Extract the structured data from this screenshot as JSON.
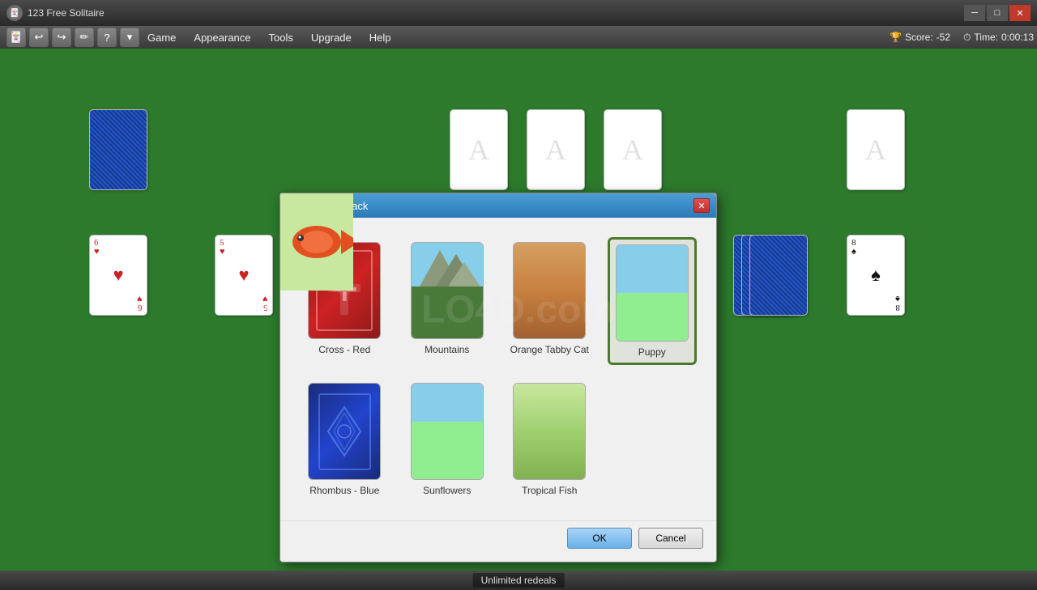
{
  "window": {
    "title": "123 Free Solitaire",
    "min_label": "─",
    "max_label": "□",
    "close_label": "✕"
  },
  "toolbar": {
    "icons": [
      "🃏",
      "↩",
      "↪",
      "✏",
      "?",
      "▾"
    ]
  },
  "menu": {
    "items": [
      "Game",
      "Appearance",
      "Tools",
      "Upgrade",
      "Help"
    ]
  },
  "hud": {
    "score_label": "Score:",
    "score_value": "-52",
    "time_label": "Time:",
    "time_value": "0:00:13"
  },
  "status_bar": {
    "message": "Unlimited redeals"
  },
  "dialog": {
    "title": "Select Card Back",
    "close_label": "✕",
    "cards": [
      {
        "id": "cross-red",
        "label": "Cross - Red",
        "selected": false
      },
      {
        "id": "mountains",
        "label": "Mountains",
        "selected": false
      },
      {
        "id": "orange-tabby",
        "label": "Orange Tabby Cat",
        "selected": false
      },
      {
        "id": "puppy",
        "label": "Puppy",
        "selected": true
      },
      {
        "id": "rhombus-blue",
        "label": "Rhombus - Blue",
        "selected": false
      },
      {
        "id": "sunflowers",
        "label": "Sunflowers",
        "selected": false
      },
      {
        "id": "tropical-fish",
        "label": "Tropical Fish",
        "selected": false
      }
    ],
    "ok_label": "OK",
    "cancel_label": "Cancel"
  },
  "watermark": "LO4D.com",
  "colors": {
    "green_table": "#2d7a2d",
    "selected_border": "#4a7a2a"
  }
}
